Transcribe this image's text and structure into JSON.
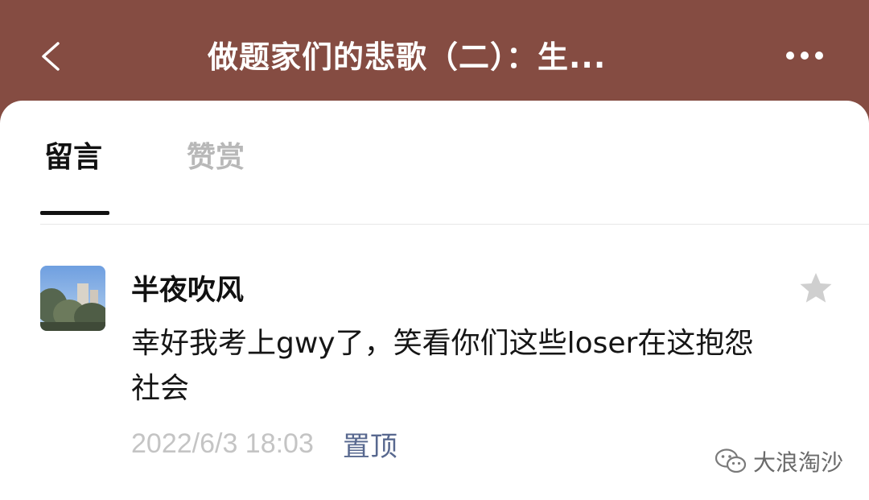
{
  "header": {
    "title": "做题家们的悲歌（二）：生...",
    "back_icon": "chevron-left-icon",
    "more_icon": "more-dots-icon",
    "background_color": "#854C42"
  },
  "tabs": [
    {
      "label": "留言",
      "active": true
    },
    {
      "label": "赞赏",
      "active": false
    }
  ],
  "comment": {
    "username": "半夜吹风",
    "text": "幸好我考上gwy了，笑看你们这些loser在这抱怨社会",
    "timestamp": "2022/6/3 18:03",
    "action_label": "置顶",
    "star_icon": "star-icon",
    "avatar": "avatar-photo"
  },
  "watermark": {
    "text": "大浪淘沙",
    "icon": "wechat-icon"
  }
}
